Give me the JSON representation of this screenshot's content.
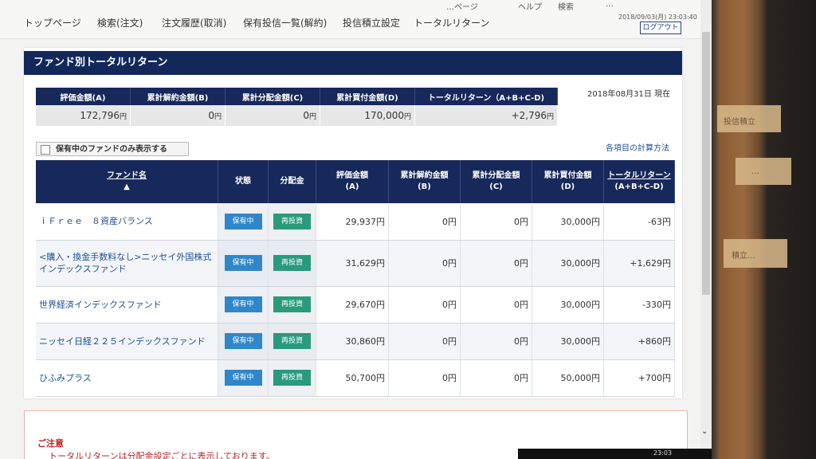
{
  "topclip": [
    "…ページ",
    "ヘルプ",
    "検索",
    "…"
  ],
  "nav": [
    "トップページ",
    "検索(注文)",
    "注文履歴(取消)",
    "保有投信一覧(解約)",
    "投信積立設定",
    "トータルリターン"
  ],
  "timestamp": "2018/09/03(月) 23:03:40",
  "logout": "ログアウト",
  "section_title": "ファンド別トータルリターン",
  "summary": {
    "headers": [
      "評価金額(A)",
      "累計解約金額(B)",
      "累計分配金額(C)",
      "累計買付金額(D)",
      "トータルリターン（A+B+C-D)"
    ],
    "values": [
      "172,796",
      "0",
      "0",
      "170,000",
      "+2,796"
    ],
    "unit": "円"
  },
  "as_of": "2018年08月31日 現在",
  "filter_label": "保有中のファンドのみ表示する",
  "calc_link": "各項目の計算方法",
  "table": {
    "headers": {
      "name": "ファンド名",
      "sort": "▲",
      "status": "状態",
      "dist": "分配金",
      "eval": "評価金額",
      "eval_sub": "(A)",
      "redeem": "累計解約金額",
      "redeem_sub": "(B)",
      "distsum": "累計分配金額",
      "distsum_sub": "(C)",
      "buy": "累計買付金額",
      "buy_sub": "(D)",
      "total": "トータルリターン",
      "total_sub": "(A+B+C-D)"
    },
    "rows": [
      {
        "name": "ｉＦｒｅｅ　８資産バランス",
        "status": "保有中",
        "dist": "再投資",
        "eval": "29,937円",
        "redeem": "0円",
        "distsum": "0円",
        "buy": "30,000円",
        "total": "-63円"
      },
      {
        "name": "<購入・換金手数料なし>ニッセイ外国株式インデックスファンド",
        "status": "保有中",
        "dist": "再投資",
        "eval": "31,629円",
        "redeem": "0円",
        "distsum": "0円",
        "buy": "30,000円",
        "total": "+1,629円"
      },
      {
        "name": "世界経済インデックスファンド",
        "status": "保有中",
        "dist": "再投資",
        "eval": "29,670円",
        "redeem": "0円",
        "distsum": "0円",
        "buy": "30,000円",
        "total": "-330円"
      },
      {
        "name": "ニッセイ日経２２５インデックスファンド",
        "status": "保有中",
        "dist": "再投資",
        "eval": "30,860円",
        "redeem": "0円",
        "distsum": "0円",
        "buy": "30,000円",
        "total": "+860円"
      },
      {
        "name": "ひふみプラス",
        "status": "保有中",
        "dist": "再投資",
        "eval": "50,700円",
        "redeem": "0円",
        "distsum": "0円",
        "buy": "50,000円",
        "total": "+700円"
      }
    ]
  },
  "caution": {
    "title": "ご注意",
    "text": "トータルリターンは分配金設定ごとに表示しております。"
  },
  "taskbar_time": "23:03",
  "notes": [
    "投信積立",
    "…",
    "積立…"
  ],
  "colors": {
    "header_navy": "#17285a",
    "badge_hold": "#2f87c9",
    "badge_reinvest": "#2a9a7c",
    "positive": "#c43b2f",
    "negative": "#3c6fb5",
    "link": "#1d4f9a"
  }
}
